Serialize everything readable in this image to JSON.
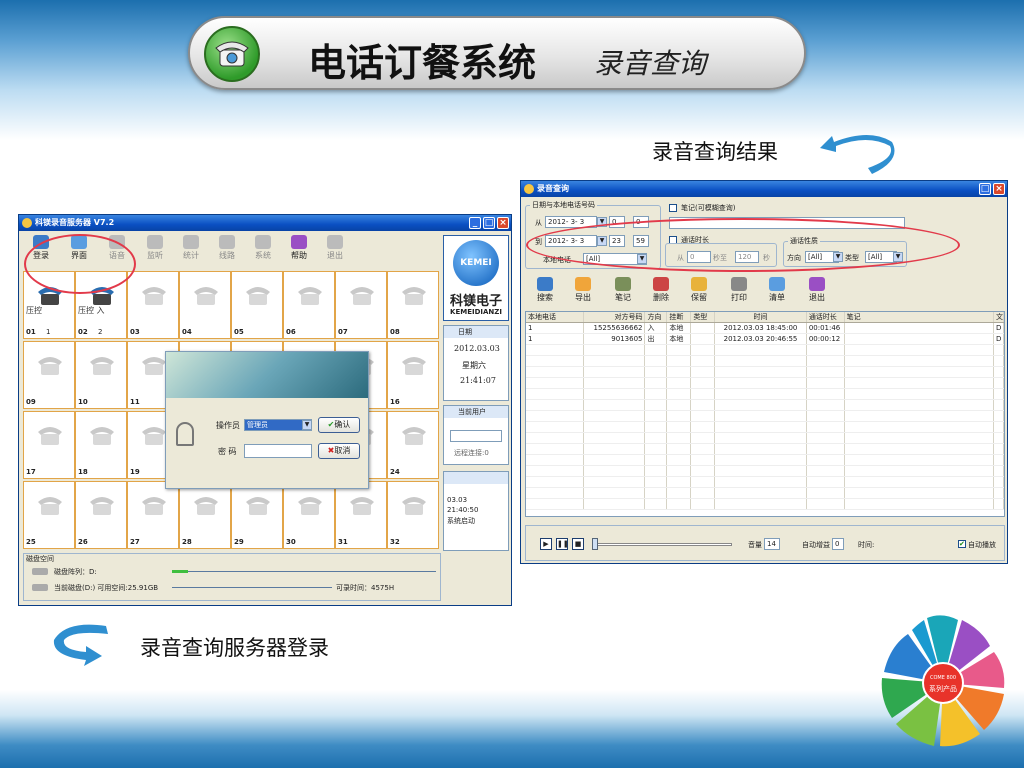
{
  "banner": {
    "title": "电话订餐系统",
    "subtitle": "录音查询"
  },
  "captions": {
    "result": "录音查询结果",
    "login": "录音查询服务器登录"
  },
  "left_window": {
    "title": "科镁录音服务器 V7.2",
    "toolbar": [
      "登录",
      "界面",
      "语音",
      "监听",
      "统计",
      "线路",
      "系统",
      "帮助",
      "退出"
    ],
    "channels": [
      {
        "num": "01",
        "count": "1",
        "label": "压控",
        "active": true
      },
      {
        "num": "02",
        "count": "2",
        "label": "压控 入",
        "active": true
      },
      {
        "num": "03"
      },
      {
        "num": "04"
      },
      {
        "num": "05"
      },
      {
        "num": "06"
      },
      {
        "num": "07"
      },
      {
        "num": "08"
      },
      {
        "num": "09"
      },
      {
        "num": "10"
      },
      {
        "num": "11"
      },
      {
        "num": ""
      },
      {
        "num": ""
      },
      {
        "num": ""
      },
      {
        "num": ""
      },
      {
        "num": "16"
      },
      {
        "num": "17"
      },
      {
        "num": "18"
      },
      {
        "num": "19"
      },
      {
        "num": ""
      },
      {
        "num": ""
      },
      {
        "num": ""
      },
      {
        "num": ""
      },
      {
        "num": "24"
      },
      {
        "num": "25"
      },
      {
        "num": "26"
      },
      {
        "num": "27"
      },
      {
        "num": "28"
      },
      {
        "num": "29"
      },
      {
        "num": "30"
      },
      {
        "num": "31"
      },
      {
        "num": "32"
      }
    ],
    "brand": {
      "logo": "KEMEI",
      "name": "科镁电子",
      "pinyin": "KEMEIDIANZI"
    },
    "date_panel": {
      "title": "日期",
      "date": "2012.03.03",
      "weekday": "星期六",
      "time": "21:41:07"
    },
    "user_panel": {
      "title": "当前用户",
      "remote": "远程连接:0"
    },
    "log": {
      "date": "03.03",
      "time": "21:40:50",
      "msg": "系统启动"
    },
    "disk": {
      "title": "磁盘空间",
      "array": "磁盘阵列：D:",
      "current": "当前磁盘(D:) 可用空间:25.91GB",
      "record": "可录时间：4575H"
    },
    "login": {
      "operator_label": "操作员",
      "operator_value": "管理员",
      "password_label": "密  码",
      "ok": "确认",
      "cancel": "取消"
    }
  },
  "right_window": {
    "title": "录音查询",
    "date_group": "日期与本地电话号码",
    "from_label": "从",
    "from_date": "2012- 3- 3",
    "from_h": "0",
    "from_m": "0",
    "to_label": "到",
    "to_date": "2012- 3- 3",
    "to_h": "23",
    "to_m": "59",
    "local_label": "本地电话",
    "local_value": "[All]",
    "note_label": "笔记(可模糊查询)",
    "duration_label": "通话时长",
    "dur_from": "从",
    "dur_from_val": "0",
    "dur_mid": "秒至",
    "dur_to_val": "120",
    "dur_unit": "秒",
    "props_group": "通话性质",
    "dir_label": "方向",
    "dir_value": "[All]",
    "type_label": "类型",
    "type_value": "[All]",
    "toolbar": [
      "搜索",
      "导出",
      "笔记",
      "删除",
      "保留",
      "打印",
      "清单",
      "退出"
    ],
    "columns": [
      "本地电话",
      "对方号码",
      "方向",
      "挂断",
      "类型",
      "时间",
      "通话时长",
      "笔记",
      "文"
    ],
    "rows": [
      [
        "1",
        "15255636662",
        "入",
        "本地",
        "",
        "2012.03.03 18:45:00",
        "00:01:46",
        "",
        "D"
      ],
      [
        "1",
        "9013605",
        "出",
        "本地",
        "",
        "2012.03.03 20:46:55",
        "00:00:12",
        "",
        "D"
      ]
    ],
    "player": {
      "volume_label": "音量",
      "volume": "14",
      "gain_label": "自动增益",
      "gain": "0",
      "time_label": "时间:",
      "autoplay": "自动播放"
    }
  },
  "wheel": {
    "center_top": "COME 800",
    "center_bottom": "系列产品"
  }
}
